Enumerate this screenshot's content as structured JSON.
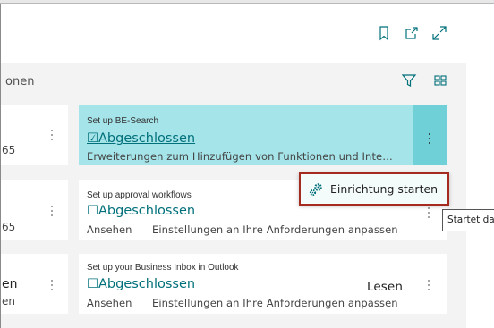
{
  "toolbar": {
    "label": "onen"
  },
  "colors": {
    "accent": "#00707a",
    "highlight_card": "#a5e4e9",
    "highlight_button": "#6fd0d8",
    "menu_border": "#a52a20"
  },
  "left_cards": [
    {
      "line1": "",
      "line2": "65"
    },
    {
      "line1": "",
      "line2": "65"
    },
    {
      "line1": "en",
      "line2": "en"
    }
  ],
  "cards": [
    {
      "title": "Set up BE-Search",
      "status": "☑Abgeschlossen",
      "description": "Erweiterungen zum Hinzufügen von Funktionen und Inte…"
    },
    {
      "title": "Set up approval workflows",
      "status": "☐Abgeschlossen",
      "link": "Ansehen",
      "description": "Einstellungen an Ihre Anforderungen anpassen"
    },
    {
      "title": "Set up your Business Inbox in Outlook",
      "status": "☐Abgeschlossen",
      "action": "Lesen",
      "link": "Ansehen",
      "description": "Einstellungen an Ihre Anforderungen anpassen"
    }
  ],
  "context_menu": {
    "item_label": "Einrichtung starten"
  },
  "tooltip": {
    "text": "Startet da"
  }
}
